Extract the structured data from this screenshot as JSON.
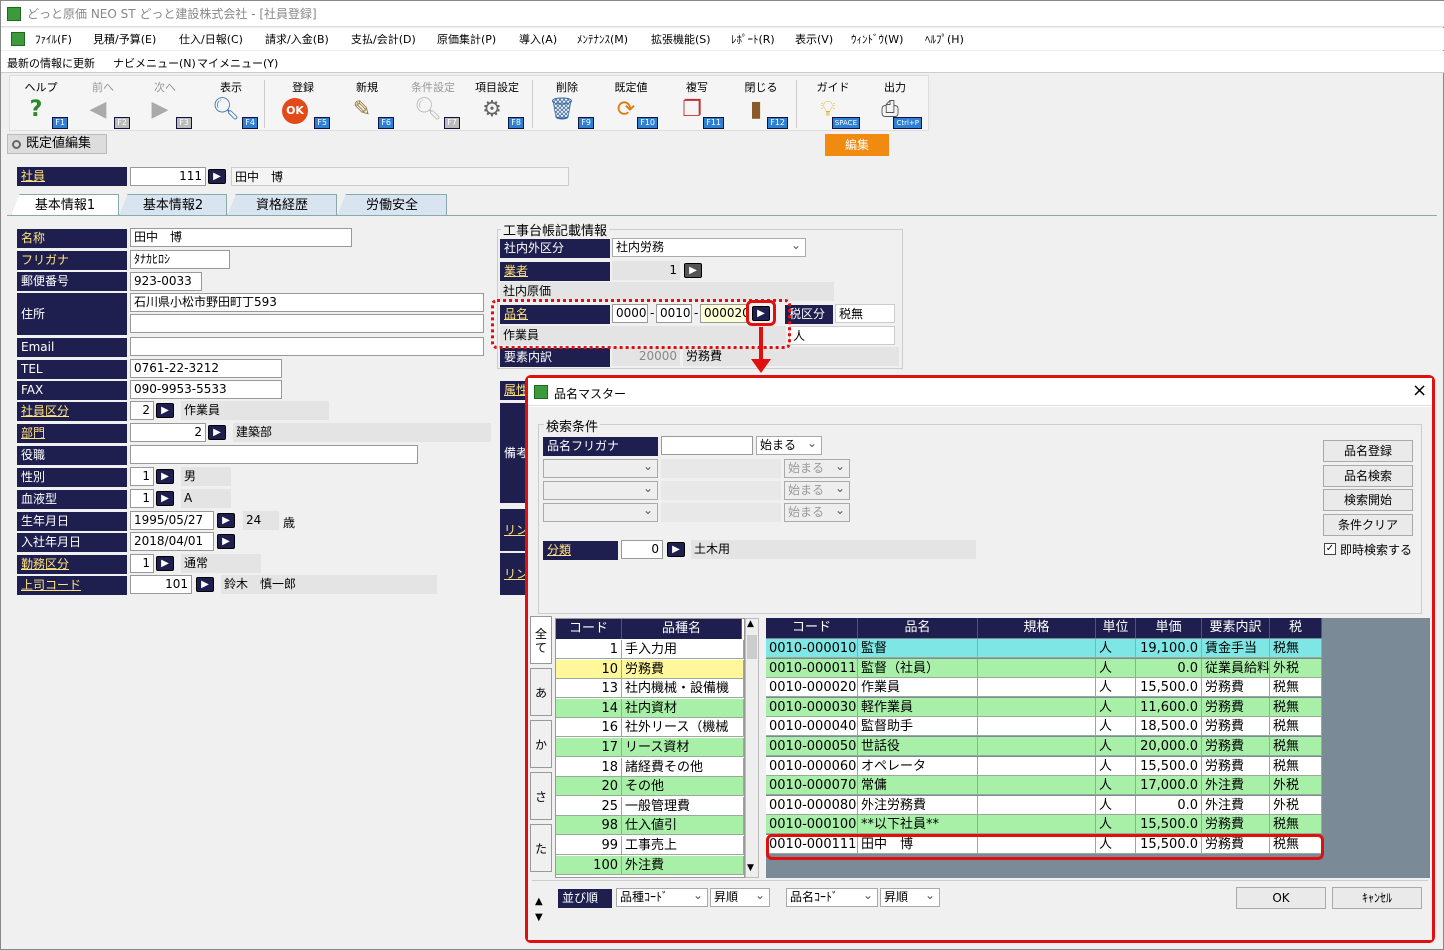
{
  "window": {
    "title": "どっと原価 NEO ST どっと建設株式会社 - [社員登録]"
  },
  "menu": [
    "ﾌｧｲﾙ(F)",
    "見積/予算(E)",
    "仕入/日報(C)",
    "請求/入金(B)",
    "支払/会計(D)",
    "原価集計(P)",
    "導入(A)",
    "ﾒﾝﾃﾅﾝｽ(M)",
    "拡張機能(S)",
    "ﾚﾎﾟｰﾄ(R)",
    "表示(V)",
    "ｳｨﾝﾄﾞｳ(W)",
    "ﾍﾙﾌﾟ(H)"
  ],
  "links": [
    "最新の情報に更新",
    "ナビメニュー(N)",
    "マイメニュー(Y)"
  ],
  "toolbar": [
    {
      "label": "ヘルプ",
      "icon": "help-icon",
      "key": "F1",
      "enabled": true
    },
    {
      "label": "前へ",
      "icon": "prev-icon",
      "key": "F2",
      "enabled": false
    },
    {
      "label": "次へ",
      "icon": "next-icon",
      "key": "F3",
      "enabled": false
    },
    {
      "label": "表示",
      "icon": "search-icon",
      "key": "F4",
      "enabled": true
    },
    {
      "label": "登録",
      "icon": "ok-icon",
      "key": "F5",
      "enabled": true
    },
    {
      "label": "新規",
      "icon": "new-icon",
      "key": "F6",
      "enabled": true
    },
    {
      "label": "条件設定",
      "icon": "filter-icon",
      "key": "F7",
      "enabled": false
    },
    {
      "label": "項目設定",
      "icon": "settings-icon",
      "key": "F8",
      "enabled": true
    },
    {
      "label": "削除",
      "icon": "trash-icon",
      "key": "F9",
      "enabled": true
    },
    {
      "label": "既定値",
      "icon": "refresh-icon",
      "key": "F10",
      "enabled": true
    },
    {
      "label": "複写",
      "icon": "copy-icon",
      "key": "F11",
      "enabled": true
    },
    {
      "label": "閉じる",
      "icon": "door-icon",
      "key": "F12",
      "enabled": true
    },
    {
      "label": "ガイド",
      "icon": "bulb-icon",
      "key": "SPACE",
      "enabled": true
    },
    {
      "label": "出力",
      "icon": "print-icon",
      "key": "Ctrl+P",
      "enabled": true
    }
  ],
  "mode_label": "既定値編集",
  "edit_badge": "編集",
  "employee": {
    "label": "社員",
    "code": "111",
    "name": "田中　博"
  },
  "tabs": [
    "基本情報1",
    "基本情報2",
    "資格経歴",
    "労働安全"
  ],
  "fields": {
    "name_label": "名称",
    "name": "田中　博",
    "kana_label": "フリガナ",
    "kana": "ﾀﾅｶﾋﾛｼ",
    "zip_label": "郵便番号",
    "zip": "923-0033",
    "addr_label": "住所",
    "addr1": "石川県小松市野田町丁593",
    "addr2": "",
    "email_label": "Email",
    "email": "",
    "tel_label": "TEL",
    "tel": "0761-22-3212",
    "fax_label": "FAX",
    "fax": "090-9953-5533",
    "emp_type_label": "社員区分",
    "emp_type_code": "2",
    "emp_type": "作業員",
    "dept_label": "部門",
    "dept_code": "2",
    "dept": "建築部",
    "role_label": "役職",
    "role": "",
    "gender_label": "性別",
    "gender_code": "1",
    "gender": "男",
    "blood_label": "血液型",
    "blood_code": "1",
    "blood": "A",
    "birth_label": "生年月日",
    "birth": "1995/05/27",
    "age": "24",
    "age_unit": "歳",
    "join_label": "入社年月日",
    "join": "2018/04/01",
    "work_label": "勤務区分",
    "work_code": "1",
    "work": "通常",
    "boss_label": "上司コード",
    "boss_code": "101",
    "boss": "鈴木　慎一郎"
  },
  "ledger": {
    "title": "工事台帳記載情報",
    "inout_label": "社内外区分",
    "inout": "社内労務",
    "vendor_label": "業者",
    "vendor_code": "1",
    "cost_note": "社内原価",
    "item_label": "品名",
    "item_c1": "0000",
    "item_c2": "0010",
    "item_c3": "000020",
    "tax_label": "税区分",
    "tax": "税無",
    "item_name": "作業員",
    "unit": "人",
    "element_label": "要素内訳",
    "element_code": "20000",
    "element": "労務費",
    "attr_label": "属性",
    "remarks_label": "備考",
    "link1": "リンク",
    "link2": "リンク"
  },
  "dialog": {
    "title": "品名マスター",
    "close": "×",
    "search_group": "検索条件",
    "kana_label": "品名フリガナ",
    "kana_value": "",
    "match": "始まる",
    "match_dis": "始まる",
    "buttons": [
      "品名登録",
      "品名検索",
      "検索開始",
      "条件クリア"
    ],
    "instant_label": "即時検索する",
    "category_label": "分類",
    "category_code": "0",
    "category": "土木用",
    "index_tabs": [
      "全て",
      "あ",
      "か",
      "さ",
      "た"
    ],
    "left_headers": [
      "コード",
      "品種名"
    ],
    "left_rows": [
      [
        "1",
        "手入力用"
      ],
      [
        "10",
        "労務費"
      ],
      [
        "13",
        "社内機械・設備機"
      ],
      [
        "14",
        "社内資材"
      ],
      [
        "16",
        "社外リース（機械"
      ],
      [
        "17",
        "リース資材"
      ],
      [
        "18",
        "諸経費その他"
      ],
      [
        "20",
        "その他"
      ],
      [
        "25",
        "一般管理費"
      ],
      [
        "98",
        "仕入値引"
      ],
      [
        "99",
        "工事売上"
      ],
      [
        "100",
        "外注費"
      ]
    ],
    "right_headers": [
      "コード",
      "品名",
      "規格",
      "単位",
      "単価",
      "要素内訳",
      "税"
    ],
    "right_rows": [
      [
        "0010-000010",
        "監督",
        "",
        "人",
        "19,100.0",
        "賃金手当",
        "税無"
      ],
      [
        "0010-000011",
        "監督（社員）",
        "",
        "人",
        "0.0",
        "従業員給料",
        "外税"
      ],
      [
        "0010-000020",
        "作業員",
        "",
        "人",
        "15,500.0",
        "労務費",
        "税無"
      ],
      [
        "0010-000030",
        "軽作業員",
        "",
        "人",
        "11,600.0",
        "労務費",
        "税無"
      ],
      [
        "0010-000040",
        "監督助手",
        "",
        "人",
        "18,500.0",
        "労務費",
        "税無"
      ],
      [
        "0010-000050",
        "世話役",
        "",
        "人",
        "20,000.0",
        "労務費",
        "税無"
      ],
      [
        "0010-000060",
        "オペレータ",
        "",
        "人",
        "15,500.0",
        "労務費",
        "税無"
      ],
      [
        "0010-000070",
        "常傭",
        "",
        "人",
        "17,000.0",
        "外注費",
        "外税"
      ],
      [
        "0010-000080",
        "外注労務費",
        "",
        "人",
        "0.0",
        "外注費",
        "外税"
      ],
      [
        "0010-000100",
        "**以下社員**",
        "",
        "人",
        "15,500.0",
        "労務費",
        "税無"
      ],
      [
        "0010-000111",
        "田中　博",
        "",
        "人",
        "15,500.0",
        "労務費",
        "税無"
      ]
    ],
    "sort_label": "並び順",
    "sort1": "品種ｺｰﾄﾞ",
    "order1": "昇順",
    "sort2": "品名ｺｰﾄﾞ",
    "order2": "昇順",
    "ok": "OK",
    "cancel": "ｷｬﾝｾﾙ"
  }
}
